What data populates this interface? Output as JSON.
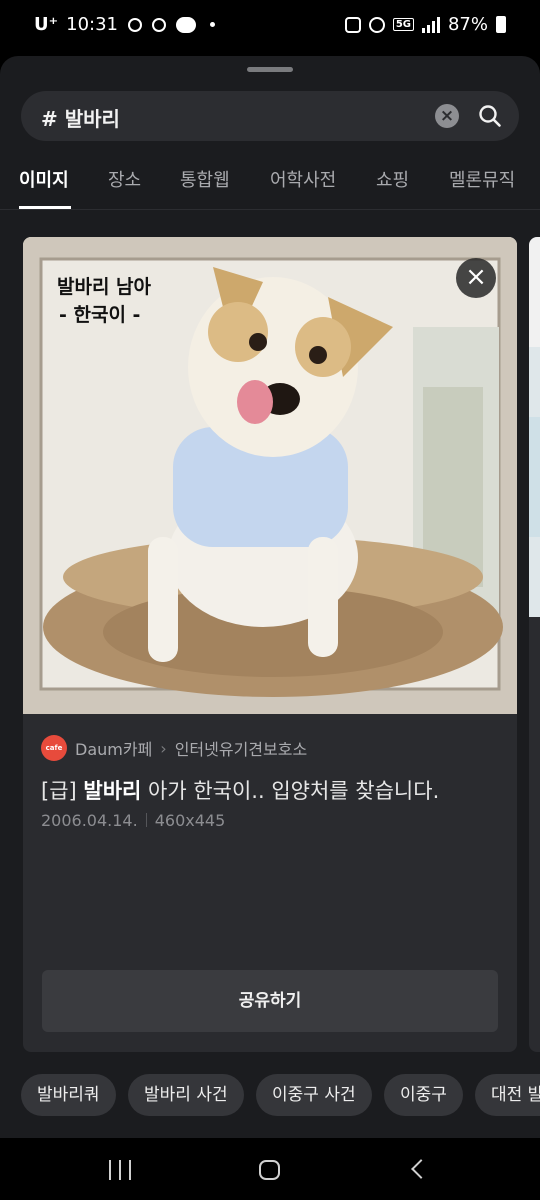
{
  "status_bar": {
    "carrier": "U⁺",
    "time": "10:31",
    "network": "5G",
    "battery": "87%"
  },
  "search": {
    "query": "# 발바리"
  },
  "tabs": [
    {
      "label": "이미지",
      "active": true
    },
    {
      "label": "장소",
      "active": false
    },
    {
      "label": "통합웹",
      "active": false
    },
    {
      "label": "어학사전",
      "active": false
    },
    {
      "label": "쇼핑",
      "active": false
    },
    {
      "label": "멜론뮤직",
      "active": false
    }
  ],
  "card": {
    "image_caption_line1": "발바리 남아",
    "image_caption_line2": "- 한국이 -",
    "source_logo": "cafe",
    "source_name": "Daum카페",
    "source_sub": "인터넷유기견보호소",
    "headline_prefix": "[급] ",
    "headline_bold": "발바리",
    "headline_rest": " 아가 한국이.. 입양처를 찾습니다.",
    "date": "2006.04.14.",
    "dimensions": "460x445",
    "share_label": "공유하기"
  },
  "related_chips": [
    "발바리쿼",
    "발바리 사건",
    "이중구 사건",
    "이중구",
    "대전 발바리"
  ],
  "icons": {
    "search": "search-icon",
    "clear": "clear-icon",
    "close": "close-icon",
    "nav_recent": "recent-apps-icon",
    "nav_home": "home-icon",
    "nav_back": "back-icon"
  }
}
